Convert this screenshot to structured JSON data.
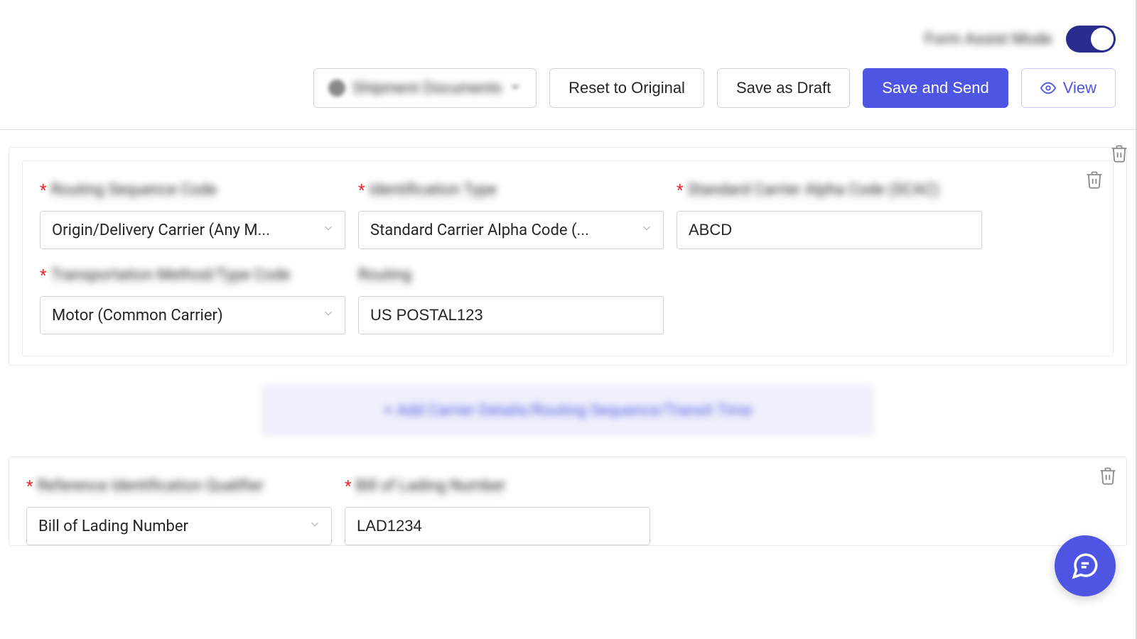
{
  "header": {
    "toggle_label": "Form Assist Mode",
    "toggle_on": true
  },
  "buttons": {
    "shipment_docs": "Shipment Documents",
    "reset": "Reset to Original",
    "save_draft": "Save as Draft",
    "save_send": "Save and Send",
    "view": "View"
  },
  "section1": {
    "fields": {
      "routing_seq": {
        "label": "Routing Sequence Code",
        "value": "Origin/Delivery Carrier (Any M..."
      },
      "id_type": {
        "label": "Identification Type",
        "value": "Standard Carrier Alpha Code (..."
      },
      "scac": {
        "label": "Standard Carrier Alpha Code (SCAC)",
        "value": "ABCD"
      },
      "trans_method": {
        "label": "Transportation Method/Type Code",
        "value": "Motor (Common Carrier)"
      },
      "routing": {
        "label": "Routing",
        "value": "US POSTAL123"
      }
    }
  },
  "add_button_label": "+  Add Carrier Details/Routing Sequence/Transit Time",
  "section2": {
    "fields": {
      "ref_qual": {
        "label": "Reference Identification Qualifier",
        "value": "Bill of Lading Number"
      },
      "bol": {
        "label": "Bill of Lading Number",
        "value": "LAD1234"
      }
    }
  }
}
